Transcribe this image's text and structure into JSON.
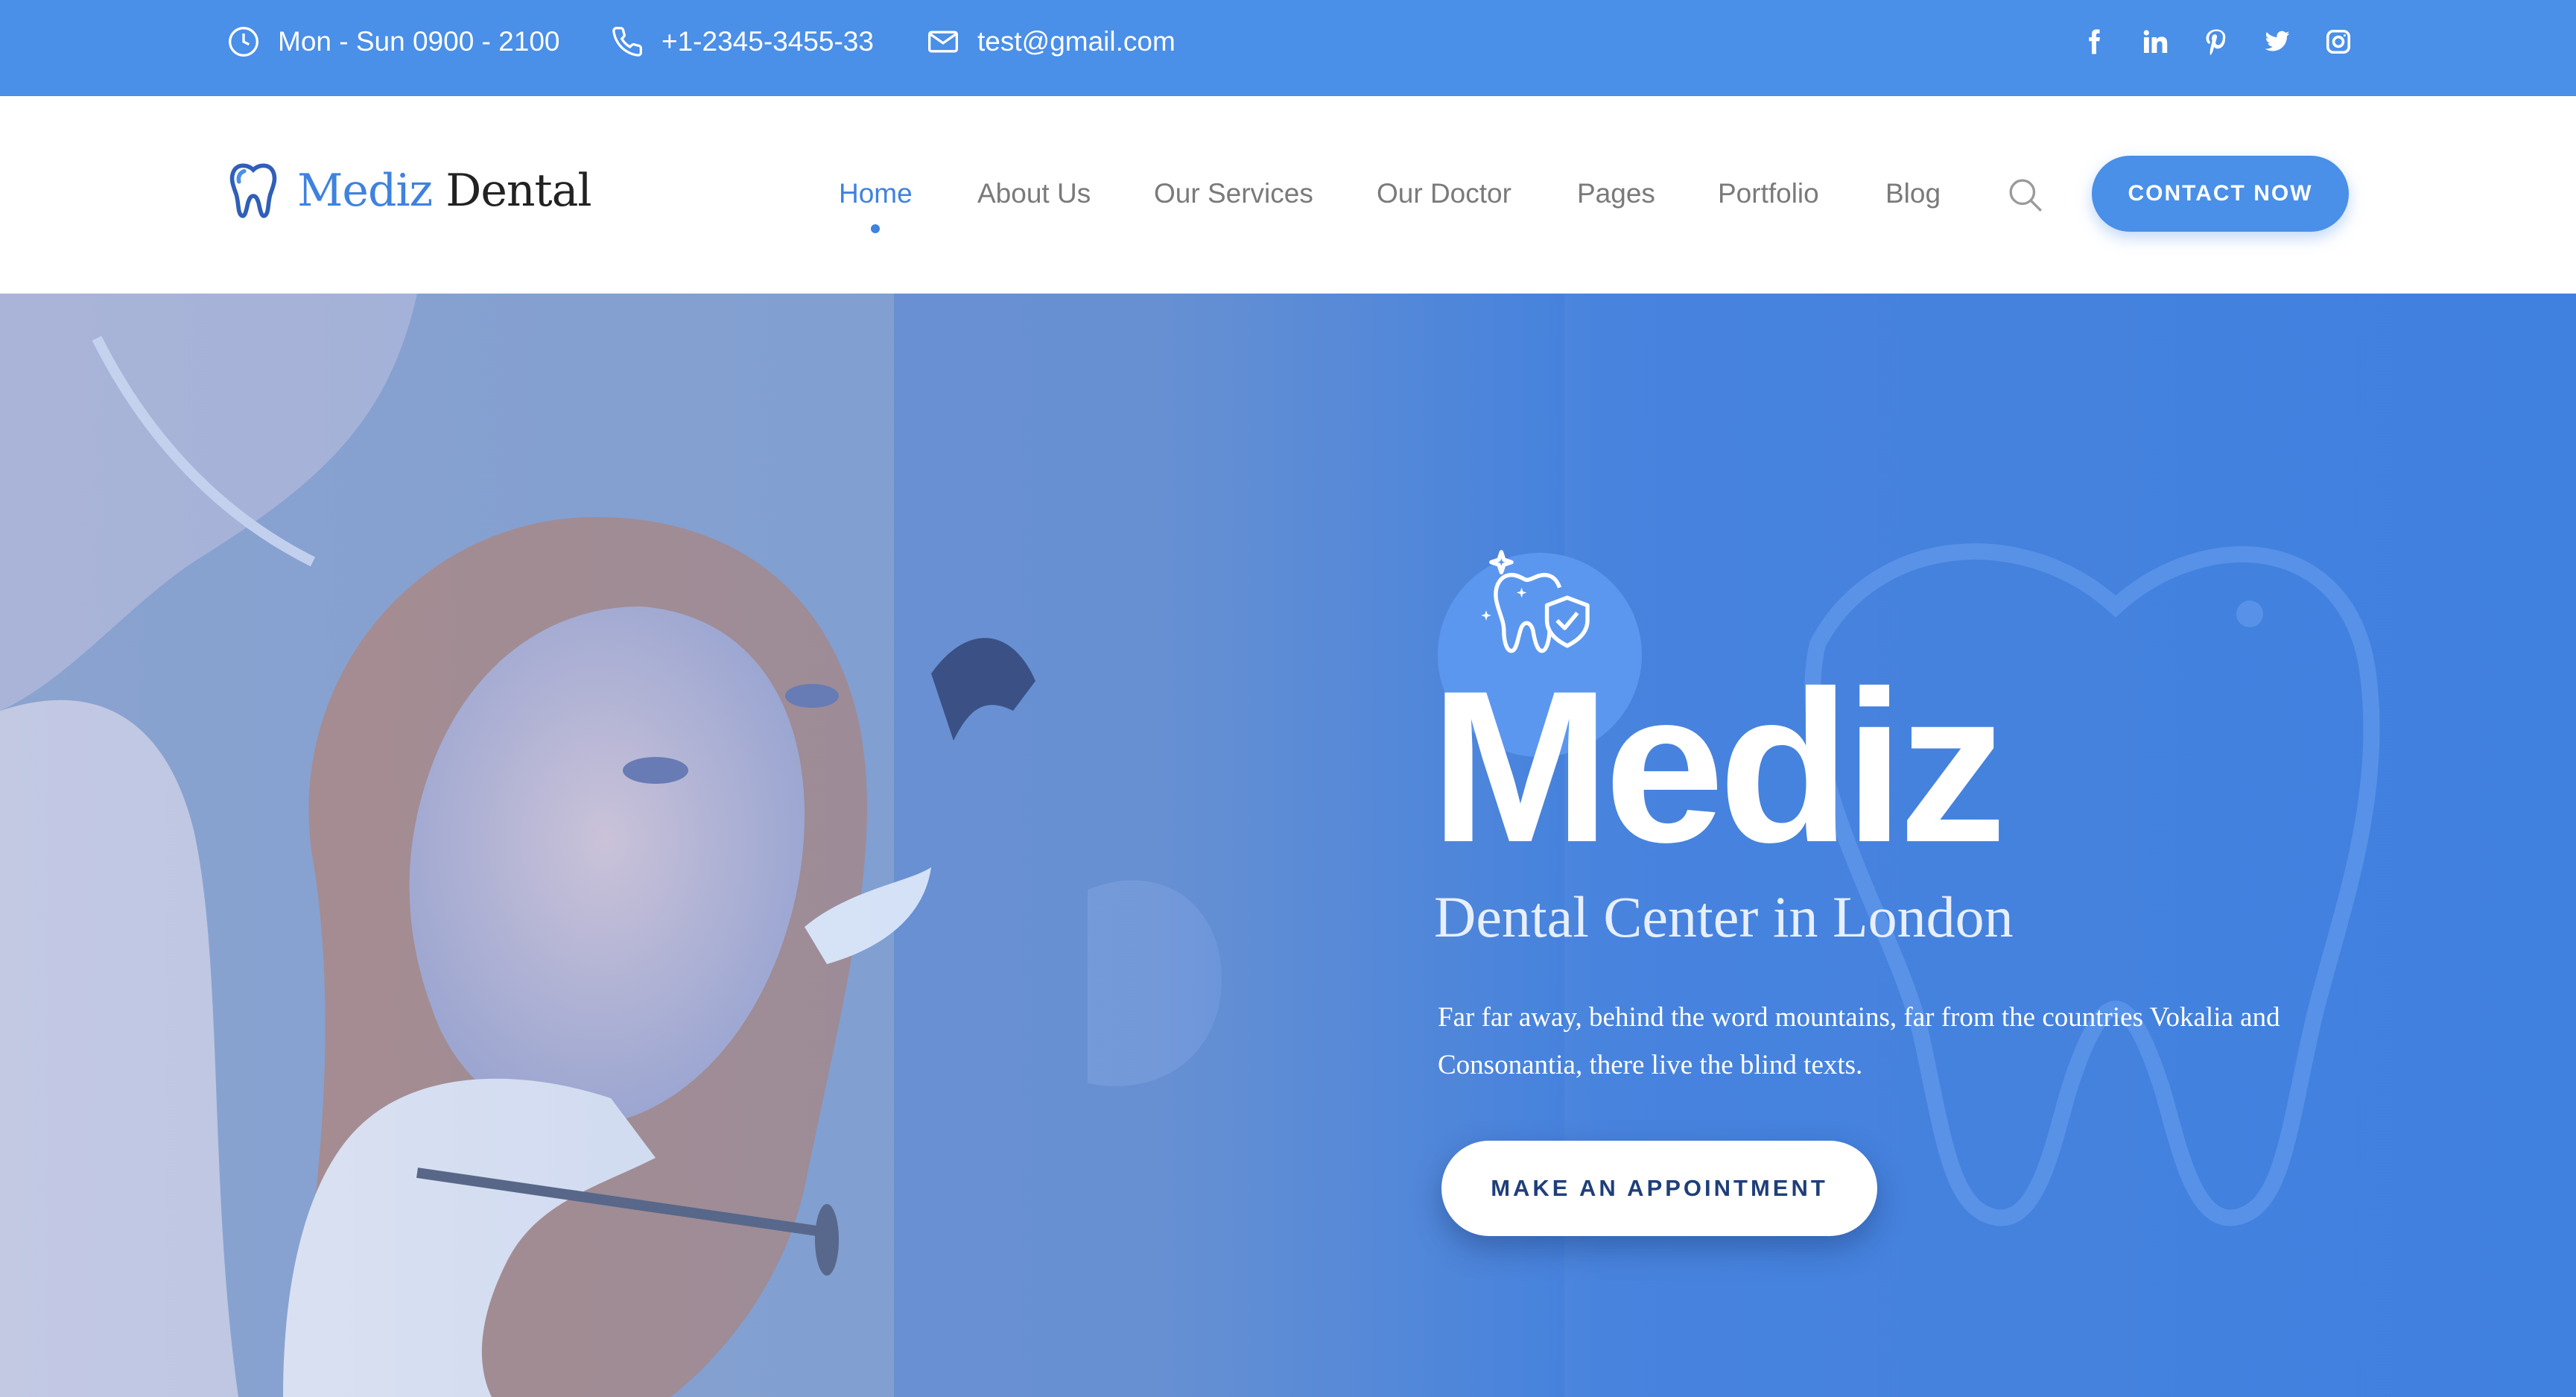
{
  "topbar": {
    "hours": "Mon - Sun 0900 - 2100",
    "phone": "+1-2345-3455-33",
    "email": "test@gmail.com",
    "social_icons": [
      "facebook-icon",
      "linkedin-icon",
      "pinterest-icon",
      "twitter-icon",
      "instagram-icon"
    ]
  },
  "header": {
    "logo": {
      "brand_first": "Mediz",
      "brand_second": "Dental",
      "icon": "tooth-icon"
    },
    "nav": [
      {
        "label": "Home",
        "active": true
      },
      {
        "label": "About Us",
        "active": false
      },
      {
        "label": "Our Services",
        "active": false
      },
      {
        "label": "Our Doctor",
        "active": false
      },
      {
        "label": "Pages",
        "active": false
      },
      {
        "label": "Portfolio",
        "active": false
      },
      {
        "label": "Blog",
        "active": false
      }
    ],
    "search_icon": "search-icon",
    "contact_button": "CONTACT NOW"
  },
  "hero": {
    "icon": "tooth-shield-icon",
    "title": "Mediz",
    "subtitle": "Dental Center in London",
    "text": "Far far away, behind the word mountains, far from the countries Vokalia and Consonantia, there live the blind texts.",
    "cta": "MAKE AN APPOINTMENT"
  },
  "colors": {
    "primary": "#4a8fe8",
    "accent": "#3f82df",
    "nav_text": "#7a7a7a",
    "cta_text": "#1f3f7a"
  }
}
